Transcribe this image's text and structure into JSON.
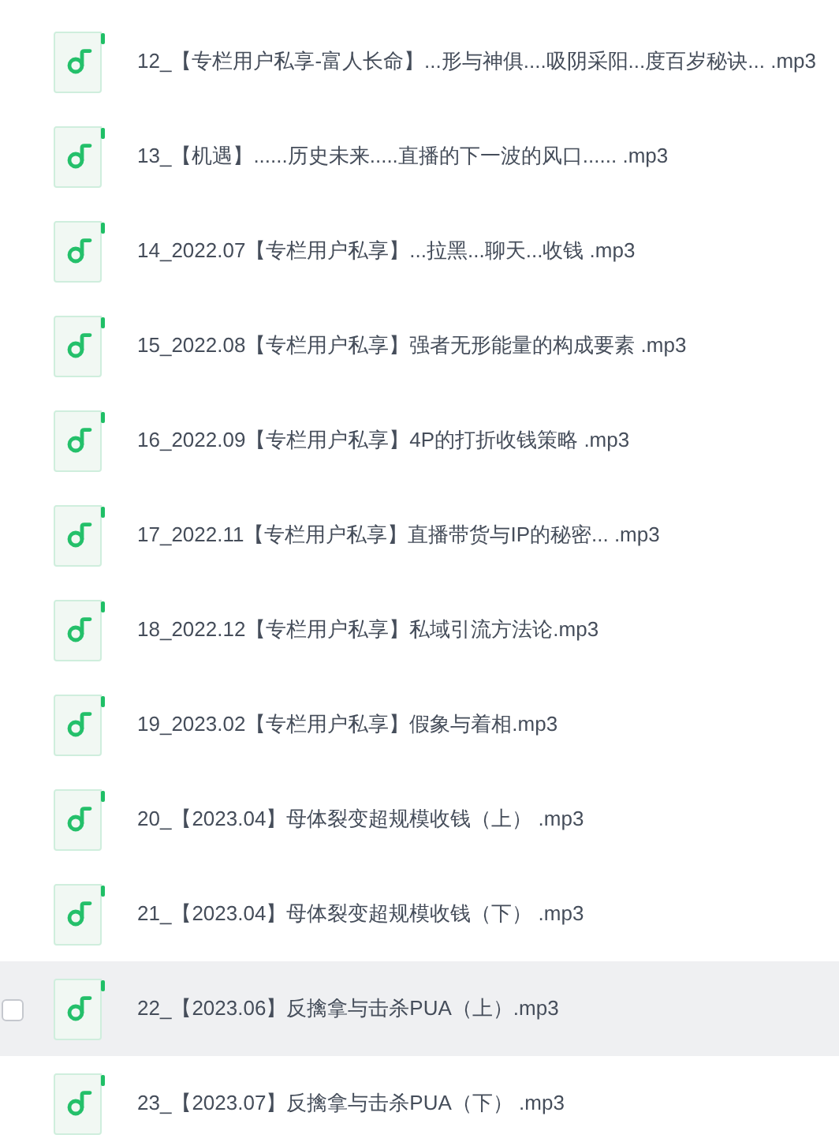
{
  "files": [
    {
      "name": "12_【专栏用户私享-富人长命】...形与神俱....吸阴采阳...度百岁秘诀... .mp3",
      "hovered": false
    },
    {
      "name": "13_【机遇】......历史未来.....直播的下一波的风口...... .mp3",
      "hovered": false
    },
    {
      "name": "14_2022.07【专栏用户私享】...拉黑...聊天...收钱 .mp3",
      "hovered": false
    },
    {
      "name": "15_2022.08【专栏用户私享】强者无形能量的构成要素 .mp3",
      "hovered": false
    },
    {
      "name": "16_2022.09【专栏用户私享】4P的打折收钱策略 .mp3",
      "hovered": false
    },
    {
      "name": "17_2022.11【专栏用户私享】直播带货与IP的秘密... .mp3",
      "hovered": false
    },
    {
      "name": "18_2022.12【专栏用户私享】私域引流方法论.mp3",
      "hovered": false
    },
    {
      "name": "19_2023.02【专栏用户私享】假象与着相.mp3",
      "hovered": false
    },
    {
      "name": "20_【2023.04】母体裂变超规模收钱（上） .mp3",
      "hovered": false
    },
    {
      "name": "21_【2023.04】母体裂变超规模收钱（下） .mp3",
      "hovered": false
    },
    {
      "name": "22_【2023.06】反擒拿与击杀PUA（上）.mp3",
      "hovered": true
    },
    {
      "name": "23_【2023.07】反擒拿与击杀PUA（下） .mp3",
      "hovered": false
    }
  ]
}
